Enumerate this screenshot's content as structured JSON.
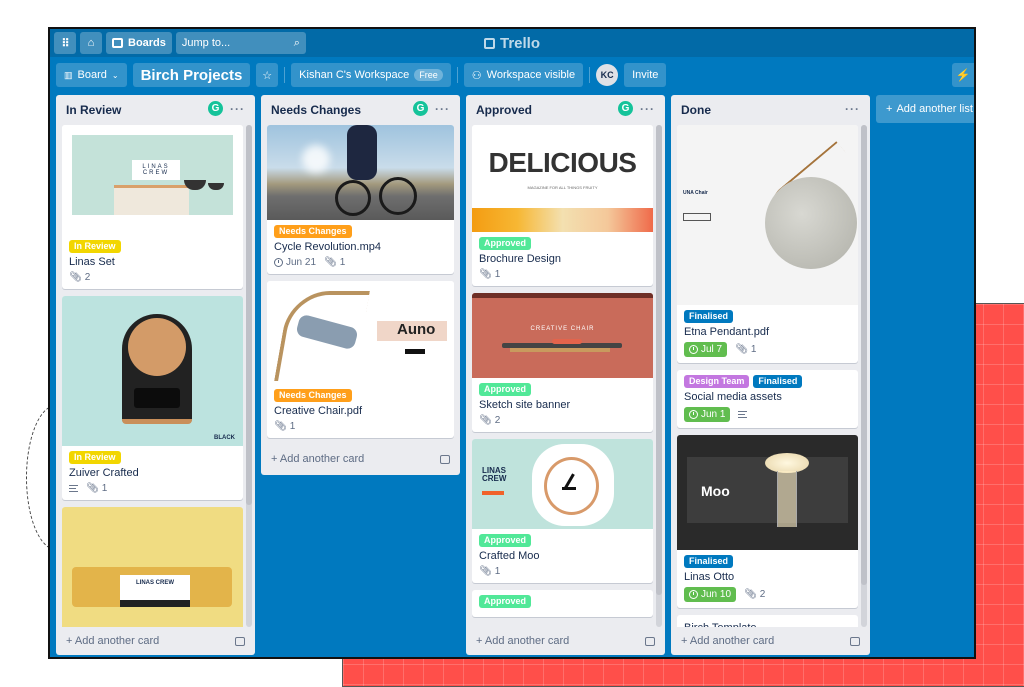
{
  "colors": {
    "board_bg": "#0079bf",
    "topbar_bg": "#026aa7",
    "label_in_review": "#f2d600",
    "label_needs_changes": "#ff9f1a",
    "label_approved": "#51e898",
    "label_finalised": "#0079bf",
    "label_design_team": "#c377e0",
    "due_complete": "#61bd4f",
    "background_panel": "#ff4f4a"
  },
  "topbar": {
    "apps_icon": "grid-icon",
    "home_icon": "home-icon",
    "boards_label": "Boards",
    "jump_placeholder": "Jump to...",
    "search_icon": "search-icon",
    "logo_text": "Trello"
  },
  "boardbar": {
    "view_label": "Board",
    "board_title": "Birch Projects",
    "workspace_label": "Kishan C's Workspace",
    "workspace_badge": "Free",
    "visibility_label": "Workspace visible",
    "avatar_initials": "KC",
    "invite_label": "Invite"
  },
  "lists": [
    {
      "title": "In Review",
      "has_grammarly": true,
      "cards": [
        {
          "cover": "linas-crew-website",
          "labels": [
            {
              "text": "In Review",
              "color": "#f2d600"
            }
          ],
          "title": "Linas Set",
          "attachments": "2"
        },
        {
          "cover": "zuiver-clock",
          "labels": [
            {
              "text": "In Review",
              "color": "#f2d600"
            }
          ],
          "title": "Zuiver Crafted",
          "has_description": true,
          "attachments": "1"
        },
        {
          "cover": "yellow-linas-crew",
          "labels": [],
          "title": ""
        }
      ],
      "add_card_label": "Add another card"
    },
    {
      "title": "Needs Changes",
      "has_grammarly": true,
      "cards": [
        {
          "cover": "cyclist-photo",
          "labels": [
            {
              "text": "Needs Changes",
              "color": "#ff9f1a"
            }
          ],
          "title": "Cycle Revolution.mp4",
          "due": "Jun 21",
          "attachments": "1"
        },
        {
          "cover": "auno-chair",
          "labels": [
            {
              "text": "Needs Changes",
              "color": "#ff9f1a"
            }
          ],
          "title": "Creative Chair.pdf",
          "attachments": "1"
        }
      ],
      "add_card_label": "Add another card"
    },
    {
      "title": "Approved",
      "has_grammarly": true,
      "cards": [
        {
          "cover": "delicious-magazine",
          "cover_title": "DELICIOUS",
          "cover_subtitle": "MAGAZINE FOR ALL THINGS FRUITY",
          "labels": [
            {
              "text": "Approved",
              "color": "#51e898"
            }
          ],
          "title": "Brochure Design",
          "attachments": "1"
        },
        {
          "cover": "creative-chair-banner",
          "cover_title": "CREATIVE CHAIR",
          "labels": [
            {
              "text": "Approved",
              "color": "#51e898"
            }
          ],
          "title": "Sketch site banner",
          "attachments": "2"
        },
        {
          "cover": "linas-crew-clock",
          "cover_title": "LINAS CREW",
          "labels": [
            {
              "text": "Approved",
              "color": "#51e898"
            }
          ],
          "title": "Crafted Moo",
          "attachments": "1"
        },
        {
          "labels": [
            {
              "text": "Approved",
              "color": "#51e898"
            }
          ],
          "title": ""
        }
      ],
      "add_card_label": "Add another card"
    },
    {
      "title": "Done",
      "has_grammarly": false,
      "cards": [
        {
          "cover": "speaker-product",
          "cover_title": "UNA Chair",
          "labels": [
            {
              "text": "Finalised",
              "color": "#0079bf"
            }
          ],
          "title": "Etna Pendant.pdf",
          "due": "Jul 7",
          "attachments": "1"
        },
        {
          "labels": [
            {
              "text": "Design Team",
              "color": "#c377e0"
            },
            {
              "text": "Finalised",
              "color": "#0079bf"
            }
          ],
          "title": "Social media assets",
          "due": "Jun 1",
          "has_description": true
        },
        {
          "cover": "moo-lamp",
          "cover_title": "Moo",
          "labels": [
            {
              "text": "Finalised",
              "color": "#0079bf"
            }
          ],
          "title": "Linas Otto",
          "due": "Jun 10",
          "attachments": "2"
        },
        {
          "labels": [],
          "title": "Birch Template"
        }
      ],
      "add_card_label": "Add another card"
    }
  ],
  "add_list_label": "Add another list",
  "misc_cover_text": {
    "linas_crew": "LINAS CREW",
    "auno": "Auno",
    "black": "BLACK"
  }
}
